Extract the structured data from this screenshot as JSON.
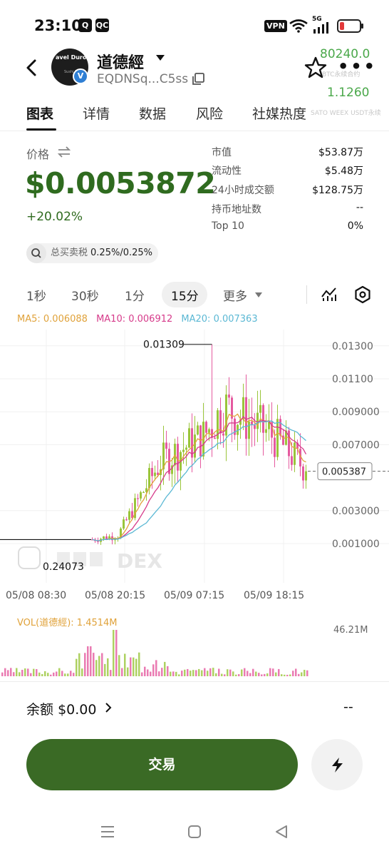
{
  "status_bar": {
    "time": "23:10",
    "app_badges": [
      "Q",
      "QC"
    ],
    "vpn": "VPN",
    "net": "5G"
  },
  "header": {
    "avatar_text": "avel Durov",
    "avatar_sub": "Sushi Post",
    "chain_badge": "V",
    "token_name": "道德經",
    "address": "EQDNSq...C5ss",
    "overlay_price": "80240.0",
    "overlay_small": "BTC永续合约",
    "overlay_price2": "1.1260"
  },
  "tabs": [
    "图表",
    "详情",
    "数据",
    "风险",
    "社媒热度"
  ],
  "tab_ticker": "SATO WEEX USDT永续",
  "price": {
    "label": "价格",
    "value": "$0.0053872",
    "change": "+20.02%"
  },
  "stats": [
    {
      "label": "市值",
      "value": "$53.87万"
    },
    {
      "label": "流动性",
      "value": "$5.48万"
    },
    {
      "label": "24小时成交额",
      "value": "$128.75万"
    },
    {
      "label": "持币地址数",
      "value": "--"
    },
    {
      "label": "Top 10",
      "value": "0%"
    }
  ],
  "tax": {
    "label": "总买卖税",
    "value": "0.25%/0.25%"
  },
  "intervals": [
    "1秒",
    "30秒",
    "1分",
    "15分"
  ],
  "active_interval": "15分",
  "more_label": "更多",
  "ma": {
    "ma5": "MA5: 0.006088",
    "ma10": "MA10: 0.006912",
    "ma20": "MA20: 0.007363",
    "colors": {
      "ma5": "#e0a23a",
      "ma10": "#d63a8a",
      "ma20": "#5bb8d4"
    }
  },
  "chart_data": {
    "type": "candlestick",
    "y_ticks": [
      "0.01300",
      "0.01100",
      "0.009000",
      "0.007000",
      "0.005387",
      "0.003000",
      "0.001000"
    ],
    "x_ticks": [
      "05/08 08:30",
      "05/08 20:15",
      "05/09 07:15",
      "05/09 18:15"
    ],
    "high_label": "0.01309",
    "low_label": "0.24073",
    "current_price": "0.005387",
    "watermark": "DEX",
    "colors": {
      "up": "#9ac53a",
      "down": "#e55a9f"
    }
  },
  "volume": {
    "legend": "VOL(道德經): 1.4514M",
    "max": "46.21M"
  },
  "balance": {
    "label": "余额",
    "value": "$0.00",
    "right": "--"
  },
  "trade_button": "交易"
}
